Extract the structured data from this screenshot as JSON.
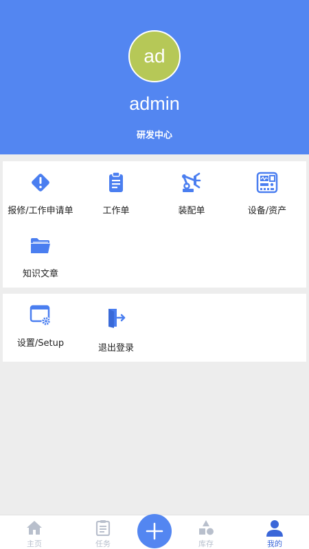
{
  "profile": {
    "avatar_initials": "ad",
    "username": "admin",
    "department": "研发中心",
    "avatar_color": "#b6c857",
    "header_color": "#5386f1"
  },
  "menu_main": [
    {
      "label": "报修/工作申请单",
      "icon": "warning-diamond-icon"
    },
    {
      "label": "工作单",
      "icon": "clipboard-icon"
    },
    {
      "label": "装配单",
      "icon": "robot-arm-icon"
    },
    {
      "label": "设备/资产",
      "icon": "device-panel-icon"
    },
    {
      "label": "知识文章",
      "icon": "folder-open-icon"
    }
  ],
  "menu_settings": [
    {
      "label": "设置/Setup",
      "icon": "window-gear-icon"
    },
    {
      "label": "退出登录",
      "icon": "logout-door-icon"
    }
  ],
  "tabbar": {
    "tabs": [
      {
        "label": "主页",
        "icon": "home-icon",
        "active": false
      },
      {
        "label": "任务",
        "icon": "clipboard-icon",
        "active": false
      },
      {
        "label": "库存",
        "icon": "shapes-icon",
        "active": false
      },
      {
        "label": "我的",
        "icon": "user-icon",
        "active": true
      }
    ],
    "fab_icon": "plus-icon",
    "active_color": "#3a66d8",
    "inactive_color": "#b8bfcc"
  }
}
